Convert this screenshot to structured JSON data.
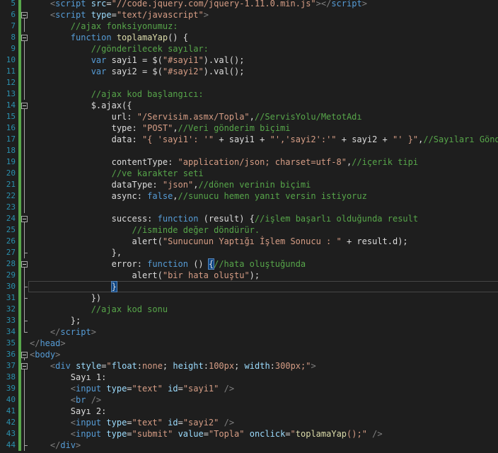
{
  "editor": {
    "colors": {
      "background": "#1e1e1e",
      "line_number": "#2b91af",
      "change_bar": "#57a64a",
      "tag_bracket": "#808080",
      "tag": "#569cd6",
      "attribute": "#9cdcfe",
      "string": "#d69d85",
      "comment": "#57a64a",
      "keyword": "#569cd6",
      "function_name": "#dcdcaa",
      "default": "#dcdcdc"
    },
    "lines": [
      {
        "num": "5",
        "tokens": [
          [
            "    ",
            "d"
          ],
          [
            "<",
            "b"
          ],
          [
            "script",
            "t"
          ],
          [
            " ",
            "d"
          ],
          [
            "src",
            "a"
          ],
          [
            "=",
            "d"
          ],
          [
            "\"//code.jquery.com/jquery-1.11.0.min.js\"",
            "s"
          ],
          [
            "></",
            "b"
          ],
          [
            "script",
            "t"
          ],
          [
            ">",
            "b"
          ]
        ]
      },
      {
        "num": "6",
        "fold": "open",
        "tokens": [
          [
            "    ",
            "d"
          ],
          [
            "<",
            "b"
          ],
          [
            "script",
            "t"
          ],
          [
            " ",
            "d"
          ],
          [
            "type",
            "a"
          ],
          [
            "=",
            "d"
          ],
          [
            "\"text/javascript\"",
            "s"
          ],
          [
            ">",
            "b"
          ]
        ]
      },
      {
        "num": "7",
        "tokens": [
          [
            "        //ajax fonksiyonumuz:",
            "c"
          ]
        ]
      },
      {
        "num": "8",
        "fold": "open",
        "tokens": [
          [
            "        ",
            "d"
          ],
          [
            "function",
            "k"
          ],
          [
            " ",
            "d"
          ],
          [
            "toplamaYap",
            "f"
          ],
          [
            "() {",
            "d"
          ]
        ]
      },
      {
        "num": "9",
        "tokens": [
          [
            "            //gönderilecek sayılar:",
            "c"
          ]
        ]
      },
      {
        "num": "10",
        "tokens": [
          [
            "            ",
            "d"
          ],
          [
            "var",
            "k"
          ],
          [
            " sayi1 = $(",
            "d"
          ],
          [
            "\"#sayi1\"",
            "s"
          ],
          [
            ").val();",
            "d"
          ]
        ]
      },
      {
        "num": "11",
        "tokens": [
          [
            "            ",
            "d"
          ],
          [
            "var",
            "k"
          ],
          [
            " sayi2 = $(",
            "d"
          ],
          [
            "\"#sayi2\"",
            "s"
          ],
          [
            ").val();",
            "d"
          ]
        ]
      },
      {
        "num": "12",
        "tokens": []
      },
      {
        "num": "13",
        "tokens": [
          [
            "            //ajax kod başlangıcı:",
            "c"
          ]
        ]
      },
      {
        "num": "14",
        "fold": "open",
        "tokens": [
          [
            "            $.ajax({",
            "d"
          ]
        ]
      },
      {
        "num": "15",
        "tokens": [
          [
            "                url: ",
            "d"
          ],
          [
            "\"/Servisim.asmx/Topla\"",
            "s"
          ],
          [
            ",",
            "d"
          ],
          [
            "//ServisYolu/MetotAdı",
            "c"
          ]
        ]
      },
      {
        "num": "16",
        "tokens": [
          [
            "                type: ",
            "d"
          ],
          [
            "\"POST\"",
            "s"
          ],
          [
            ",",
            "d"
          ],
          [
            "//Veri gönderim biçimi",
            "c"
          ]
        ]
      },
      {
        "num": "17",
        "tokens": [
          [
            "                data: ",
            "d"
          ],
          [
            "\"{ 'sayi1': '\"",
            "s"
          ],
          [
            " + sayi1 + ",
            "d"
          ],
          [
            "\"','sayi2':'\"",
            "s"
          ],
          [
            " + sayi2 + ",
            "d"
          ],
          [
            "\"' }\"",
            "s"
          ],
          [
            ",",
            "d"
          ],
          [
            "//Sayıları Gönder",
            "c"
          ]
        ]
      },
      {
        "num": "18",
        "tokens": []
      },
      {
        "num": "19",
        "tokens": [
          [
            "                contentType: ",
            "d"
          ],
          [
            "\"application/json; charset=utf-8\"",
            "s"
          ],
          [
            ",",
            "d"
          ],
          [
            "//içerik tipi",
            "c"
          ]
        ]
      },
      {
        "num": "20",
        "tokens": [
          [
            "                //ve karakter seti",
            "c"
          ]
        ]
      },
      {
        "num": "21",
        "tokens": [
          [
            "                dataType: ",
            "d"
          ],
          [
            "\"json\"",
            "s"
          ],
          [
            ",",
            "d"
          ],
          [
            "//dönen verinin biçimi",
            "c"
          ]
        ]
      },
      {
        "num": "22",
        "tokens": [
          [
            "                async: ",
            "d"
          ],
          [
            "false",
            "k"
          ],
          [
            ",",
            "d"
          ],
          [
            "//sunucu hemen yanıt versin istiyoruz",
            "c"
          ]
        ]
      },
      {
        "num": "23",
        "tokens": []
      },
      {
        "num": "24",
        "fold": "open",
        "tokens": [
          [
            "                success: ",
            "d"
          ],
          [
            "function",
            "k"
          ],
          [
            " (result) {",
            "d"
          ],
          [
            "//işlem başarlı olduğunda result",
            "c"
          ]
        ]
      },
      {
        "num": "25",
        "tokens": [
          [
            "                    //isminde değer döndürür.",
            "c"
          ]
        ]
      },
      {
        "num": "26",
        "tokens": [
          [
            "                    alert(",
            "d"
          ],
          [
            "\"Sunucunun Yaptığı İşlem Sonucu : \"",
            "s"
          ],
          [
            " + result.d);",
            "d"
          ]
        ]
      },
      {
        "num": "27",
        "tokens": [
          [
            "                },",
            "d"
          ]
        ]
      },
      {
        "num": "28",
        "fold": "open",
        "tokens": [
          [
            "                error: ",
            "d"
          ],
          [
            "function",
            "k"
          ],
          [
            " () ",
            "d"
          ],
          [
            "{",
            "h"
          ],
          [
            "//hata oluştuğunda",
            "c"
          ]
        ]
      },
      {
        "num": "29",
        "tokens": [
          [
            "                    alert(",
            "d"
          ],
          [
            "\"bir hata oluştu\"",
            "s"
          ],
          [
            ");",
            "d"
          ]
        ]
      },
      {
        "num": "30",
        "current": true,
        "tokens": [
          [
            "                ",
            "d"
          ],
          [
            "}",
            "h"
          ]
        ]
      },
      {
        "num": "31",
        "tokens": [
          [
            "            })",
            "d"
          ]
        ]
      },
      {
        "num": "32",
        "tokens": [
          [
            "            //ajax kod sonu",
            "c"
          ]
        ]
      },
      {
        "num": "33",
        "tokens": [
          [
            "        };",
            "d"
          ]
        ]
      },
      {
        "num": "34",
        "tokens": [
          [
            "    ",
            "d"
          ],
          [
            "</",
            "b"
          ],
          [
            "script",
            "t"
          ],
          [
            ">",
            "b"
          ]
        ]
      },
      {
        "num": "35",
        "tokens": [
          [
            "</",
            "b"
          ],
          [
            "head",
            "t"
          ],
          [
            ">",
            "b"
          ]
        ]
      },
      {
        "num": "36",
        "fold": "open",
        "tokens": [
          [
            "<",
            "b"
          ],
          [
            "body",
            "t"
          ],
          [
            ">",
            "b"
          ]
        ]
      },
      {
        "num": "37",
        "fold": "open",
        "tokens": [
          [
            "    ",
            "d"
          ],
          [
            "<",
            "b"
          ],
          [
            "div",
            "t"
          ],
          [
            " ",
            "d"
          ],
          [
            "style",
            "a"
          ],
          [
            "=",
            "d"
          ],
          [
            "\"",
            "s"
          ],
          [
            "float",
            "a"
          ],
          [
            ":",
            "d"
          ],
          [
            "none",
            "s"
          ],
          [
            "; ",
            "d"
          ],
          [
            "height",
            "a"
          ],
          [
            ":",
            "d"
          ],
          [
            "100px",
            "s"
          ],
          [
            "; ",
            "d"
          ],
          [
            "width",
            "a"
          ],
          [
            ":",
            "d"
          ],
          [
            "300px",
            "s"
          ],
          [
            ";\"",
            "s"
          ],
          [
            ">",
            "b"
          ]
        ]
      },
      {
        "num": "38",
        "tokens": [
          [
            "        Sayı 1:",
            "d"
          ]
        ]
      },
      {
        "num": "39",
        "tokens": [
          [
            "        ",
            "d"
          ],
          [
            "<",
            "b"
          ],
          [
            "input",
            "t"
          ],
          [
            " ",
            "d"
          ],
          [
            "type",
            "a"
          ],
          [
            "=",
            "d"
          ],
          [
            "\"text\"",
            "s"
          ],
          [
            " ",
            "d"
          ],
          [
            "id",
            "a"
          ],
          [
            "=",
            "d"
          ],
          [
            "\"sayi1\"",
            "s"
          ],
          [
            " />",
            "b"
          ]
        ]
      },
      {
        "num": "40",
        "tokens": [
          [
            "        ",
            "d"
          ],
          [
            "<",
            "b"
          ],
          [
            "br",
            "t"
          ],
          [
            " />",
            "b"
          ]
        ]
      },
      {
        "num": "41",
        "tokens": [
          [
            "        Sayı 2:",
            "d"
          ]
        ]
      },
      {
        "num": "42",
        "tokens": [
          [
            "        ",
            "d"
          ],
          [
            "<",
            "b"
          ],
          [
            "input",
            "t"
          ],
          [
            " ",
            "d"
          ],
          [
            "type",
            "a"
          ],
          [
            "=",
            "d"
          ],
          [
            "\"text\"",
            "s"
          ],
          [
            " ",
            "d"
          ],
          [
            "id",
            "a"
          ],
          [
            "=",
            "d"
          ],
          [
            "\"sayi2\"",
            "s"
          ],
          [
            " />",
            "b"
          ]
        ]
      },
      {
        "num": "43",
        "tokens": [
          [
            "        ",
            "d"
          ],
          [
            "<",
            "b"
          ],
          [
            "input",
            "t"
          ],
          [
            " ",
            "d"
          ],
          [
            "type",
            "a"
          ],
          [
            "=",
            "d"
          ],
          [
            "\"submit\"",
            "s"
          ],
          [
            " ",
            "d"
          ],
          [
            "value",
            "a"
          ],
          [
            "=",
            "d"
          ],
          [
            "\"Topla\"",
            "s"
          ],
          [
            " ",
            "d"
          ],
          [
            "onclick",
            "a"
          ],
          [
            "=",
            "d"
          ],
          [
            "\"",
            "s"
          ],
          [
            "toplamaYap",
            "f"
          ],
          [
            "();\"",
            "s"
          ],
          [
            " />",
            "b"
          ]
        ]
      },
      {
        "num": "44",
        "tokens": [
          [
            "    ",
            "d"
          ],
          [
            "</",
            "b"
          ],
          [
            "div",
            "t"
          ],
          [
            ">",
            "b"
          ]
        ]
      }
    ]
  }
}
